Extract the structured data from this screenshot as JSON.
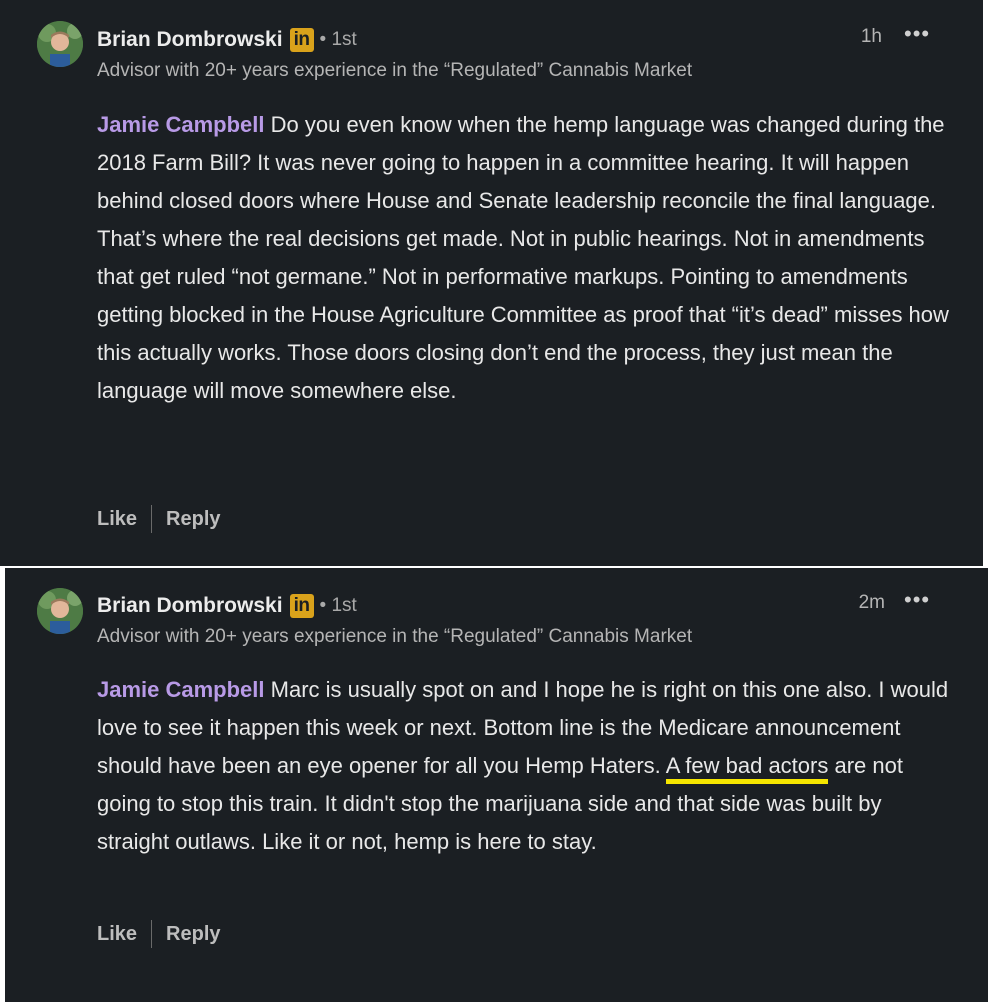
{
  "comments": [
    {
      "author": "Brian Dombrowski",
      "badge": "in",
      "degree": "• 1st",
      "headline": "Advisor with 20+ years experience in the “Regulated” Cannabis Market",
      "time": "1h",
      "more": "•••",
      "mention": "Jamie Campbell",
      "text": " Do you even know when the hemp language was changed during the 2018 Farm Bill? It was never going to happen in a committee hearing. It will happen behind closed doors where House and Senate leadership reconcile the final language. That’s where the real decisions get made. Not in public hearings. Not in amendments that get ruled “not germane.” Not in performative markups. Pointing to amendments getting blocked in the House Agriculture Committee as proof that “it’s dead” misses how this actually works. Those doors closing don’t end the process, they just mean the language will move somewhere else.",
      "like": "Like",
      "reply": "Reply"
    },
    {
      "author": "Brian Dombrowski",
      "badge": "in",
      "degree": "• 1st",
      "headline": "Advisor with 20+ years experience in the “Regulated” Cannabis Market",
      "time": "2m",
      "more": "•••",
      "mention": "Jamie Campbell",
      "text_before": " Marc is usually spot on and I hope he is right on this one also. I would love to see it happen this week or next. Bottom line is the Medicare announcement should have been an eye opener for all you Hemp Haters. ",
      "highlighted": "A few bad actors",
      "text_after": " are not going to stop this train. It didn't stop the marijuana side and that side was built by straight outlaws. Like it or not, hemp is here to stay.",
      "like": "Like",
      "reply": "Reply"
    }
  ],
  "colors": {
    "panel_bg": "#1b1f23",
    "mention": "#b89ae6",
    "highlight_underline": "#f6e600",
    "linkedin_badge": "#d9a21b"
  }
}
